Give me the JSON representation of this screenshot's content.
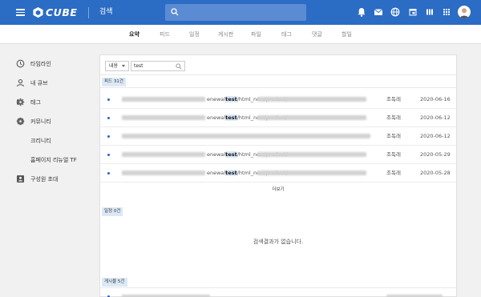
{
  "header": {
    "logo_text": "CUBE",
    "title": "검색",
    "brand_color": "#2b6cc4",
    "icons": [
      "bell-icon",
      "mail-icon",
      "globe-icon",
      "calendar-icon",
      "columns-icon",
      "apps-grid-icon"
    ]
  },
  "tabs": [
    {
      "label": "요약",
      "active": true
    },
    {
      "label": "피드"
    },
    {
      "label": "일정"
    },
    {
      "label": "게시판"
    },
    {
      "label": "파일"
    },
    {
      "label": "태그"
    },
    {
      "label": "댓글"
    },
    {
      "label": "할일"
    }
  ],
  "sidebar": {
    "items": [
      {
        "label": "타임라인",
        "icon": "clock-icon"
      },
      {
        "label": "내 큐브",
        "icon": "person-icon"
      },
      {
        "label": "태그",
        "icon": "tag-icon"
      },
      {
        "label": "커뮤니티",
        "icon": "globe-icon"
      },
      {
        "label": "크리니티"
      },
      {
        "label": "홈페이지 리뉴얼 TF"
      },
      {
        "label": "구성원 초대",
        "icon": "contact-card-icon"
      }
    ]
  },
  "search": {
    "scope": "내용",
    "query": "test"
  },
  "feed": {
    "badge": "피드 31건",
    "rows": [
      {
        "path_before": "enewal",
        "keyword": "test",
        "path_after": "/html_new/product/",
        "author": "조독래",
        "date": "2020-06-16",
        "has_link": true
      },
      {
        "path_before": "enewal",
        "keyword": "test",
        "path_after": "/html_new/product/",
        "author": "조독래",
        "date": "2020-06-12",
        "has_link": true
      },
      {
        "path_before": "",
        "keyword": "",
        "path_after": "",
        "author": "조독래",
        "date": "2020-06-12",
        "has_link": false
      },
      {
        "path_before": "enewal",
        "keyword": "test",
        "path_after": "/html_new/product/",
        "author": "조독래",
        "date": "2020-05-29",
        "has_link": true
      },
      {
        "path_before": "enewal",
        "keyword": "test",
        "path_after": "/html_new/product/",
        "author": "조독래",
        "date": "2020-05-28",
        "has_link": true
      }
    ],
    "more_label": "더보기"
  },
  "schedule": {
    "badge": "일정 0건",
    "empty_text": "검색결과가 없습니다."
  },
  "board": {
    "badge": "게시물 5건"
  }
}
